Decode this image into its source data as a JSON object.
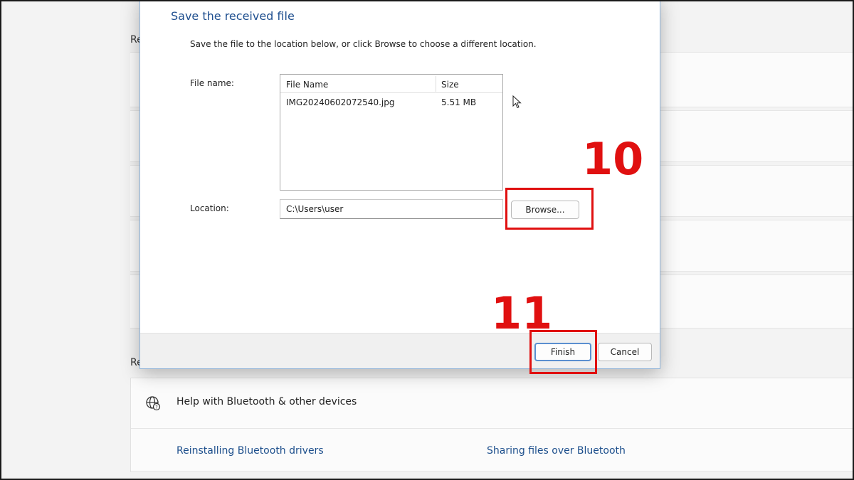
{
  "background": {
    "section_label_top": "Re",
    "section_label_bottom": "Re",
    "help": {
      "title": "Help with Bluetooth & other devices",
      "icon": "globe-help-icon",
      "links": [
        "Reinstalling Bluetooth drivers",
        "Sharing files over Bluetooth"
      ]
    }
  },
  "dialog": {
    "title": "Save the received file",
    "instruction": "Save the file to the location below, or click Browse to choose a different location.",
    "file_name_label": "File name:",
    "location_label": "Location:",
    "columns": [
      "File Name",
      "Size"
    ],
    "files": [
      {
        "name": "IMG20240602072540.jpg",
        "size": "5.51 MB"
      }
    ],
    "location_value": "C:\\Users\\user",
    "browse_label": "Browse...",
    "finish_label": "Finish",
    "cancel_label": "Cancel"
  },
  "annotations": {
    "step_browse": "10",
    "step_finish": "11",
    "color": "#e01010"
  },
  "colors": {
    "title_blue": "#1f4f8f",
    "link_blue": "#1d4f8c",
    "dialog_border": "#8fb3d9"
  }
}
